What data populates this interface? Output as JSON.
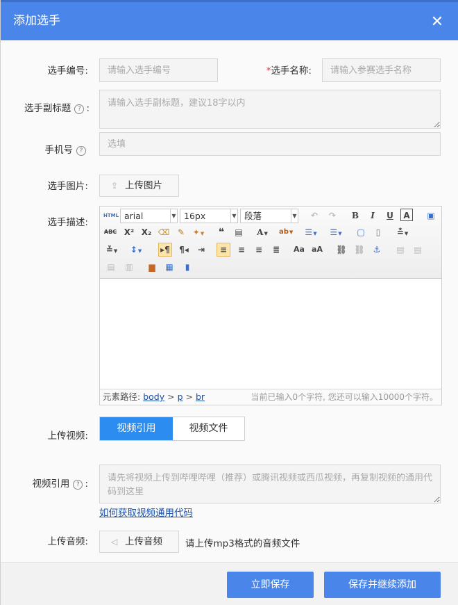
{
  "dialog": {
    "title": "添加选手",
    "close_glyph": "✕"
  },
  "fields": {
    "number": {
      "label": "选手编号:",
      "placeholder": "请输入选手编号"
    },
    "name": {
      "required_mark": "*",
      "label": "选手名称:",
      "placeholder": "请输入参赛选手名称"
    },
    "subtitle": {
      "label": "选手副标题",
      "colon": ":",
      "placeholder": "请输入选手副标题，建议18字以内"
    },
    "phone": {
      "label": "手机号",
      "placeholder": "选填"
    },
    "photo": {
      "label": "选手图片:",
      "button": "上传图片"
    },
    "description": {
      "label": "选手描述:"
    },
    "video_upload": {
      "label": "上传视频:"
    },
    "video_ref": {
      "label": "视频引用",
      "colon": ":",
      "placeholder": "请先将视频上传到哔哩哔哩（推荐）或腾讯视频或西瓜视频，再复制视频的通用代码到这里",
      "help_link": "如何获取视频通用代码"
    },
    "audio": {
      "label": "上传音频:",
      "button": "上传音频",
      "hint": "请上传mp3格式的音频文件"
    }
  },
  "editor": {
    "font_family": "arial",
    "font_size": "16px",
    "paragraph": "段落",
    "path_label": "元素路径:",
    "path": [
      "body",
      "p",
      "br"
    ],
    "path_sep": ">",
    "char_count": "当前已输入0个字符, 您还可以输入10000个字符。"
  },
  "video_tabs": [
    "视频引用",
    "视频文件"
  ],
  "buttons": {
    "save": "立即保存",
    "save_continue": "保存并继续添加"
  },
  "help_glyph": "?",
  "colors": {
    "header": "#4a86ea",
    "primary": "#4a86ea",
    "tab_active": "#2d8cf0",
    "required": "#e0392b",
    "link": "#1a4fa8"
  }
}
